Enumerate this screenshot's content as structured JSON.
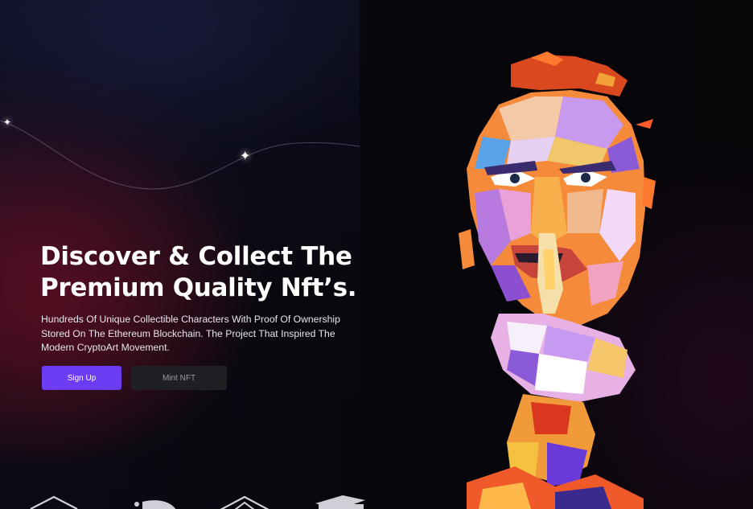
{
  "hero": {
    "title_line1": "Discover & Collect The",
    "title_line2": "Premium Quality Nft’s.",
    "description": "Hundreds Of Unique Collectible Characters With Proof Of Ownership Stored On The Ethereum Blockchain. The Project That Inspired The Modern CryptoArt Movement."
  },
  "actions": {
    "signup_label": "Sign Up",
    "mint_label": "Mint NFT"
  },
  "theme": {
    "accent": "#6c3df2",
    "secondary_button": "#1f1f24",
    "background": "#07070b",
    "text": "#ffffff"
  },
  "decorations": {
    "sparkle_icon": "sparkle-star",
    "portrait_image": "polygonal-pop-art-portrait",
    "partner_logos": [
      "partner-logo-house",
      "partner-logo-coin",
      "partner-logo-arrow",
      "partner-logo-cap"
    ]
  }
}
